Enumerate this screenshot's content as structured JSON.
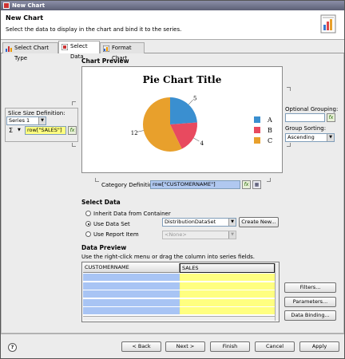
{
  "window": {
    "title": "New Chart"
  },
  "header": {
    "title": "New Chart",
    "subtitle": "Select the data to display in the chart and bind it to the series."
  },
  "tabs": [
    {
      "label": "Select Chart Type",
      "active": false
    },
    {
      "label": "Select Data",
      "active": true
    },
    {
      "label": "Format Chart",
      "active": false
    }
  ],
  "preview": {
    "label": "Chart Preview"
  },
  "chart_data": {
    "type": "pie",
    "title": "Pie Chart Title",
    "categories": [
      "A",
      "B",
      "C"
    ],
    "values": [
      5,
      4,
      12
    ],
    "colors": [
      "#3a8fd0",
      "#e84a5f",
      "#e8a02c"
    ],
    "legend": "right"
  },
  "slice": {
    "label": "Slice Size Definition:",
    "series": "Series 1",
    "sigma": "Σ",
    "expression": "row[\"SALES\"]"
  },
  "grouping": {
    "optional_label": "Optional Grouping:",
    "optional_value": "",
    "sorting_label": "Group Sorting:",
    "sorting_value": "Ascending"
  },
  "category": {
    "label": "Category Definition:",
    "value": "row[\"CUSTOMERNAME\"]"
  },
  "select_data": {
    "label": "Select Data",
    "inherit": "Inherit Data from Container",
    "use_dataset": "Use Data Set",
    "use_report": "Use Report Item",
    "dataset_value": "DistributionDataSet",
    "report_value": "<None>",
    "create_new": "Create New..."
  },
  "data_preview": {
    "label": "Data Preview",
    "hint": "Use the right-click menu or drag the column into series fields.",
    "columns": [
      "CUSTOMERNAME",
      "SALES"
    ],
    "rows": 5
  },
  "side_buttons": {
    "filters": "Filters...",
    "parameters": "Parameters...",
    "binding": "Data Binding..."
  },
  "footer": {
    "help": "?",
    "back": "< Back",
    "next": "Next >",
    "finish": "Finish",
    "cancel": "Cancel",
    "apply": "Apply"
  }
}
